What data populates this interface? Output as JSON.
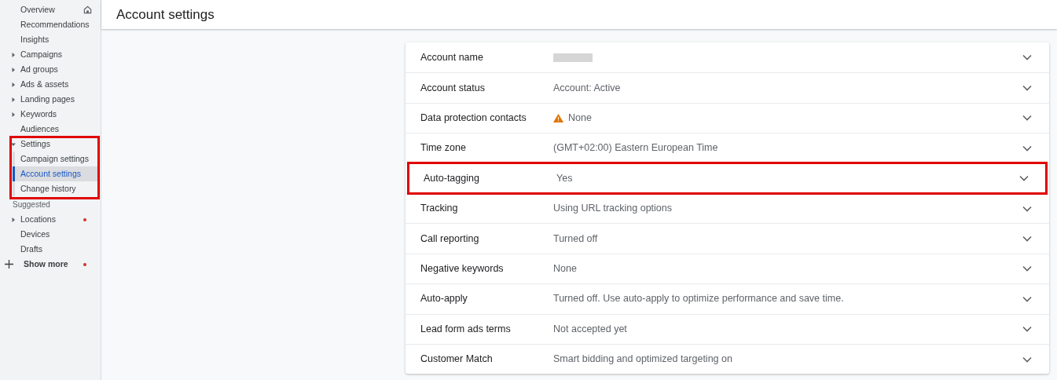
{
  "sidebar": {
    "items": [
      {
        "label": "Overview",
        "kind": "home"
      },
      {
        "label": "Recommendations",
        "kind": "item"
      },
      {
        "label": "Insights",
        "kind": "item"
      },
      {
        "label": "Campaigns",
        "kind": "collapsible",
        "expanded": false
      },
      {
        "label": "Ad groups",
        "kind": "collapsible",
        "expanded": false
      },
      {
        "label": "Ads & assets",
        "kind": "collapsible",
        "expanded": false
      },
      {
        "label": "Landing pages",
        "kind": "collapsible",
        "expanded": false
      },
      {
        "label": "Keywords",
        "kind": "collapsible",
        "expanded": false
      },
      {
        "label": "Audiences",
        "kind": "item"
      },
      {
        "label": "Settings",
        "kind": "collapsible",
        "expanded": true,
        "highlighted": true,
        "children": [
          {
            "label": "Campaign settings",
            "selected": false
          },
          {
            "label": "Account settings",
            "selected": true
          },
          {
            "label": "Change history",
            "selected": false
          }
        ]
      },
      {
        "label": "Suggested",
        "kind": "header"
      },
      {
        "label": "Locations",
        "kind": "collapsible",
        "expanded": false,
        "dot": true
      },
      {
        "label": "Devices",
        "kind": "item"
      },
      {
        "label": "Drafts",
        "kind": "item"
      },
      {
        "label": "Show more",
        "kind": "more",
        "dot": true
      }
    ]
  },
  "page": {
    "title": "Account settings"
  },
  "settings": [
    {
      "label": "Account name",
      "redacted": true,
      "highlighted": false
    },
    {
      "label": "Account status",
      "value": "Account: Active",
      "highlighted": false
    },
    {
      "label": "Data protection contacts",
      "value": "None",
      "warning": true,
      "highlighted": false
    },
    {
      "label": "Time zone",
      "value": "(GMT+02:00) Eastern European Time",
      "highlighted": false
    },
    {
      "label": "Auto-tagging",
      "value": "Yes",
      "highlighted": true
    },
    {
      "label": "Tracking",
      "value": "Using URL tracking options",
      "highlighted": false
    },
    {
      "label": "Call reporting",
      "value": "Turned off",
      "highlighted": false
    },
    {
      "label": "Negative keywords",
      "value": "None",
      "highlighted": false
    },
    {
      "label": "Auto-apply",
      "value": "Turned off. Use auto-apply to optimize performance and save time.",
      "highlighted": false
    },
    {
      "label": "Lead form ads terms",
      "value": "Not accepted yet",
      "highlighted": false
    },
    {
      "label": "Customer Match",
      "value": "Smart bidding and optimized targeting on",
      "highlighted": false
    }
  ]
}
